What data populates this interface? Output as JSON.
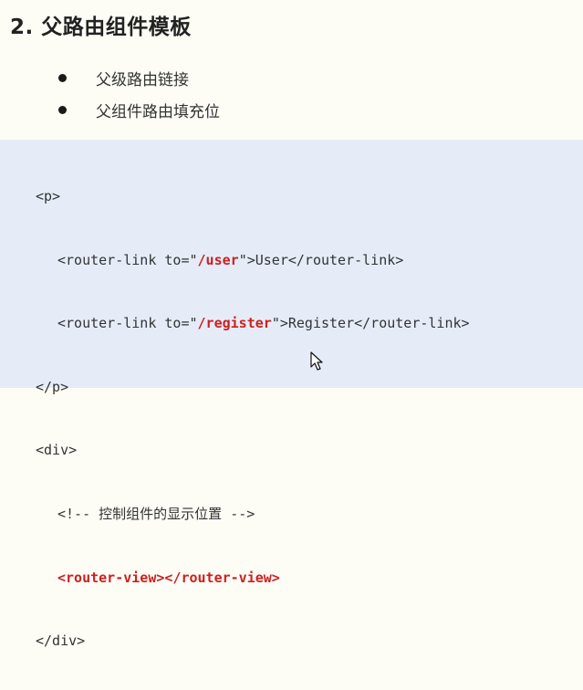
{
  "heading": "2. 父路由组件模板",
  "bullets": [
    "父级路由链接",
    "父组件路由填充位"
  ],
  "code": {
    "line1": "<p>",
    "line2": {
      "prefix": "<router-link to=\"",
      "path": "/user",
      "suffix": "\">User</router-link>"
    },
    "line3": {
      "prefix": "<router-link to=\"",
      "path": "/register",
      "suffix": "\">Register</router-link>"
    },
    "line4": "</p>",
    "line5": "<div>",
    "line6": {
      "open": "<!-- ",
      "text": "控制组件的显示位置",
      "close": " -->"
    },
    "line7": "<router-view></router-view>",
    "line8": "</div>"
  },
  "colors": {
    "highlight": "#cc2020",
    "code_background": "#e5ecf8",
    "page_background": "#fdfdf6"
  },
  "cursor": "mouse-pointer-icon"
}
